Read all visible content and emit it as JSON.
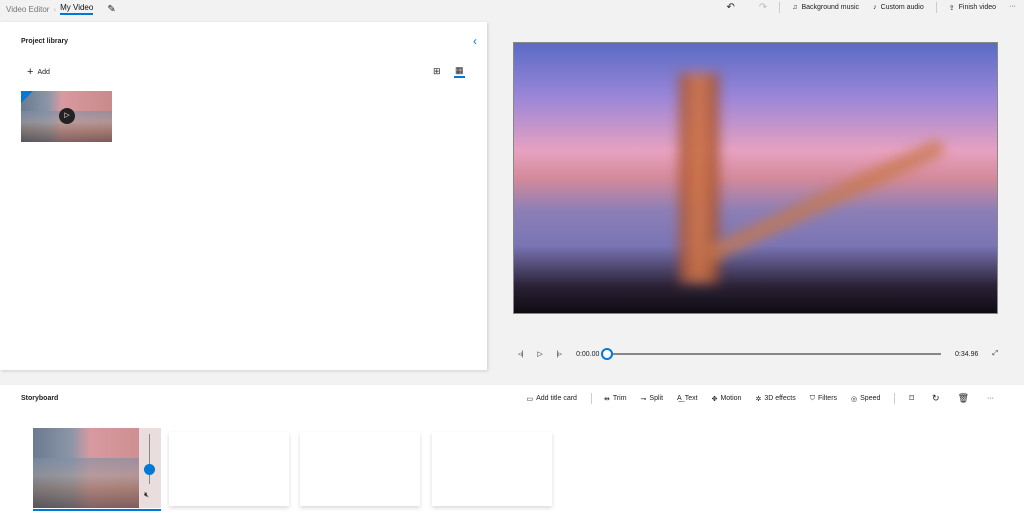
{
  "breadcrumb": {
    "root": "Video Editor",
    "current": "My Video"
  },
  "toolbar": {
    "background_music": "Background music",
    "custom_audio": "Custom audio",
    "finish_video": "Finish video",
    "more": "···"
  },
  "library": {
    "title": "Project library",
    "add": "Add"
  },
  "player": {
    "current_time": "0:00.00",
    "duration": "0:34.96",
    "progress": 0
  },
  "storyboard": {
    "title": "Storyboard",
    "tools": {
      "add_title_card": "Add title card",
      "trim": "Trim",
      "split": "Split",
      "text": "Text",
      "motion": "Motion",
      "effects3d": "3D effects",
      "filters": "Filters",
      "speed": "Speed"
    },
    "more": "···",
    "clip_volume": 0.3
  }
}
